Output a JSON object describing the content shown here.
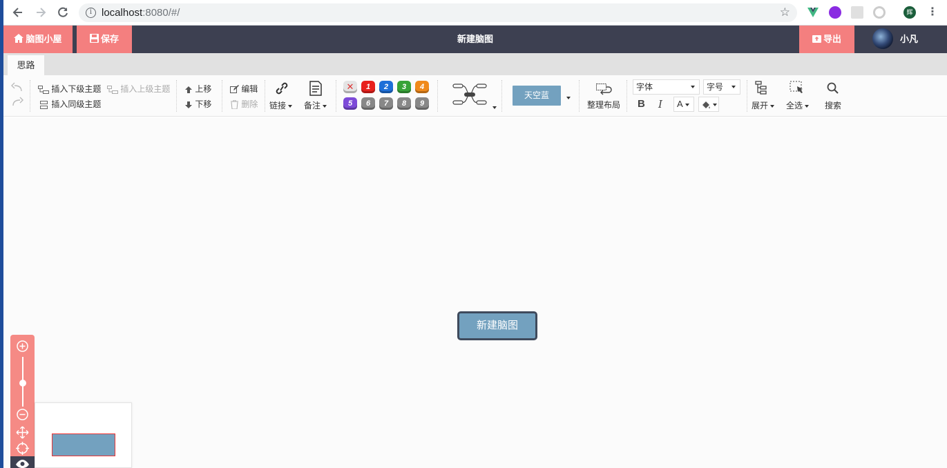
{
  "browser": {
    "url_host": "localhost",
    "url_rest": ":8080/#/",
    "ext_badge": "辉"
  },
  "app": {
    "home_label": "脑图小屋",
    "save_label": "保存",
    "title": "新建脑图",
    "export_label": "导出",
    "user_name": "小凡"
  },
  "tabs": [
    {
      "label": "思路"
    }
  ],
  "toolbar": {
    "insert_child": "插入下级主题",
    "insert_parent": "插入上级主题",
    "insert_sibling": "插入同级主题",
    "move_up": "上移",
    "move_down": "下移",
    "edit": "编辑",
    "delete": "删除",
    "link": "链接",
    "note": "备注",
    "priorities": [
      "1",
      "2",
      "3",
      "4",
      "5",
      "6",
      "7",
      "8",
      "9"
    ],
    "theme": "天空蓝",
    "arrange": "整理布局",
    "font_family": "字体",
    "font_size": "字号",
    "bold": "B",
    "italic": "I",
    "font_color": "A",
    "expand": "展开",
    "select_all": "全选",
    "search": "搜索"
  },
  "canvas": {
    "root_node": "新建脑图"
  },
  "colors": {
    "accent": "#f47f7f",
    "header": "#3d4051",
    "node": "#73a1bf",
    "priority": [
      "#e8201c",
      "#1d6fd8",
      "#37a338",
      "#f08a1b",
      "#7d4ad8",
      "#888888",
      "#888888",
      "#888888",
      "#888888"
    ]
  }
}
